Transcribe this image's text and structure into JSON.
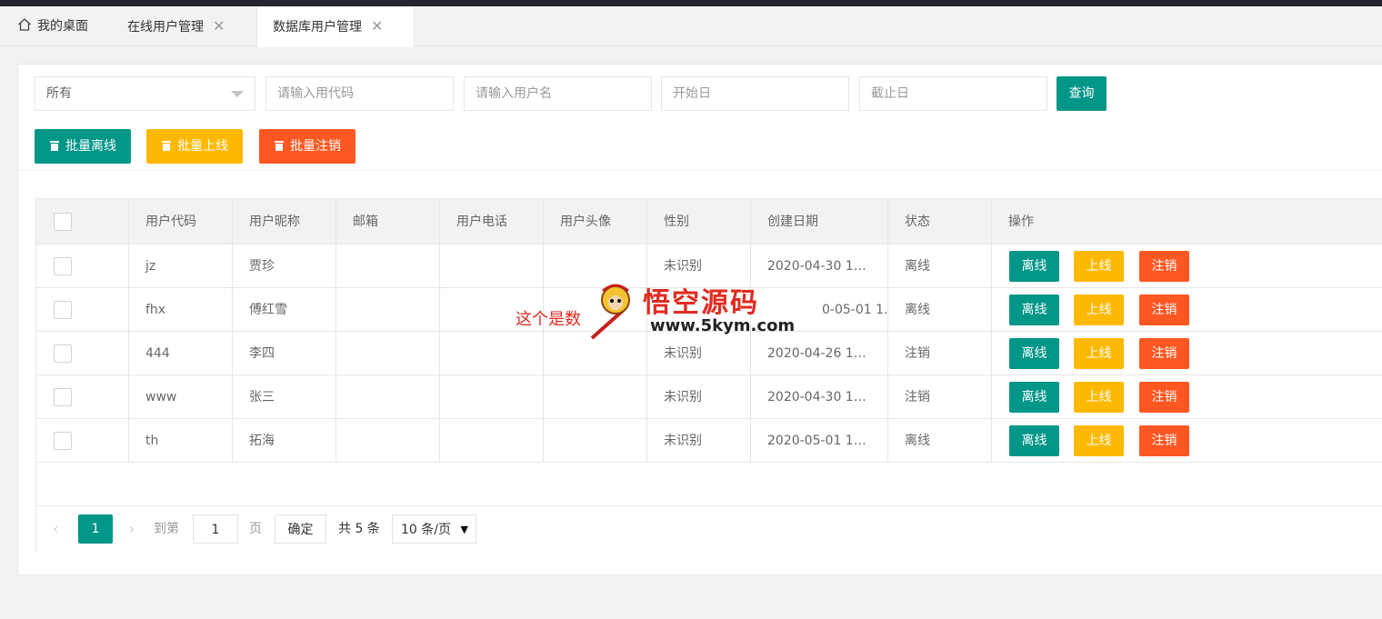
{
  "tabs": [
    {
      "label": "我的桌面",
      "icon": "home-icon",
      "closable": false,
      "active": false
    },
    {
      "label": "在线用户管理",
      "closable": true,
      "active": false
    },
    {
      "label": "数据库用户管理",
      "closable": true,
      "active": true
    }
  ],
  "filters": {
    "status_select": "所有",
    "user_code_placeholder": "请输入用代码",
    "user_name_placeholder": "请输入用户名",
    "start_date_placeholder": "开始日",
    "end_date_placeholder": "截止日",
    "search_label": "查询"
  },
  "batch": {
    "offline_label": "批量离线",
    "online_label": "批量上线",
    "cancel_label": "批量注销"
  },
  "table": {
    "columns": [
      "用户代码",
      "用户昵称",
      "邮箱",
      "用户电话",
      "用户头像",
      "性别",
      "创建日期",
      "状态",
      "操作"
    ],
    "rows": [
      {
        "code": "jz",
        "nickname": "贾珍",
        "email": "",
        "phone": "",
        "avatar": "",
        "gender": "未识别",
        "created": "2020-04-30 1…",
        "status": "离线"
      },
      {
        "code": "fhx",
        "nickname": "傅红雪",
        "email": "",
        "phone": "",
        "avatar": "",
        "gender": "",
        "created": "0-05-01 1…",
        "status": "离线"
      },
      {
        "code": "444",
        "nickname": "李四",
        "email": "",
        "phone": "",
        "avatar": "",
        "gender": "未识别",
        "created": "2020-04-26 1…",
        "status": "注销"
      },
      {
        "code": "www",
        "nickname": "张三",
        "email": "",
        "phone": "",
        "avatar": "",
        "gender": "未识别",
        "created": "2020-04-30 1…",
        "status": "注销"
      },
      {
        "code": "th",
        "nickname": "拓海",
        "email": "",
        "phone": "",
        "avatar": "",
        "gender": "未识别",
        "created": "2020-05-01 1…",
        "status": "离线"
      }
    ],
    "actions": {
      "offline": "离线",
      "online": "上线",
      "cancel": "注销"
    }
  },
  "pagination": {
    "current_page": "1",
    "goto_prefix": "到第",
    "goto_value": "1",
    "goto_suffix": "页",
    "confirm_label": "确定",
    "total_text": "共 5 条",
    "page_size": "10 条/页"
  },
  "watermark": {
    "overlay_text": "这个是数",
    "brand": "悟空源码",
    "url": "www.5kym.com"
  },
  "colors": {
    "teal": "#009688",
    "yellow": "#ffb800",
    "red": "#ff5722",
    "topbar": "#23262e"
  }
}
